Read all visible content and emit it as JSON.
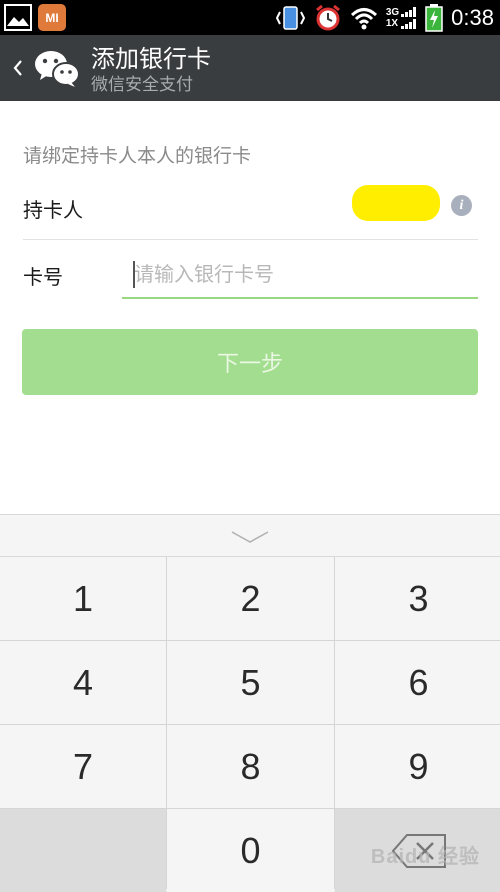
{
  "status_bar": {
    "time": "0:38",
    "network_top": "3G",
    "network_bottom": "1X",
    "left_app_badge": "MI",
    "icons": [
      "gallery-icon",
      "mi-app-icon",
      "vibrate-icon",
      "alarm-icon",
      "wifi-icon",
      "signal-icon",
      "battery-charging-icon"
    ]
  },
  "header": {
    "title": "添加银行卡",
    "subtitle": "微信安全支付"
  },
  "form": {
    "hint": "请绑定持卡人本人的银行卡",
    "holder_label": "持卡人",
    "card_label": "卡号",
    "card_placeholder": "请输入银行卡号",
    "card_value": "",
    "next_button": "下一步"
  },
  "keypad": {
    "keys": [
      "1",
      "2",
      "3",
      "4",
      "5",
      "6",
      "7",
      "8",
      "9",
      "0"
    ]
  },
  "watermark": "Baidu 经验",
  "colors": {
    "title_bar": "#3a3d3f",
    "accent_green": "#9ad783",
    "button_disabled": "#a3de90",
    "redaction": "#ffee00"
  }
}
